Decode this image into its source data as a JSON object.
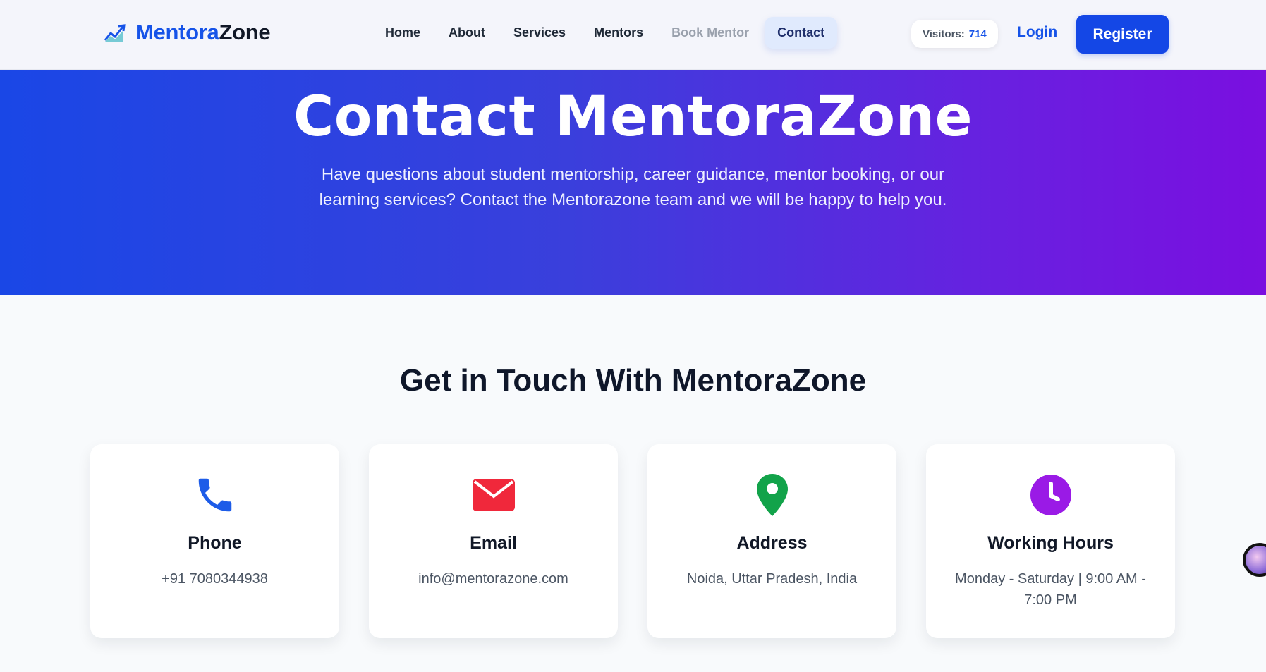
{
  "brand": {
    "name_part1": "Mentora",
    "name_part2": "Zone"
  },
  "nav": {
    "items": [
      {
        "label": "Home"
      },
      {
        "label": "About"
      },
      {
        "label": "Services"
      },
      {
        "label": "Mentors"
      },
      {
        "label": "Book Mentor"
      },
      {
        "label": "Contact"
      }
    ],
    "active": "Contact"
  },
  "visitors": {
    "label": "Visitors:",
    "count": "714"
  },
  "auth": {
    "login_label": "Login",
    "register_label": "Register"
  },
  "hero": {
    "title": "Contact MentoraZone",
    "subtitle": "Have questions about student mentorship, career guidance, mentor booking, or our learning services? Contact the Mentorazone team and we will be happy to help you."
  },
  "section": {
    "title": "Get in Touch With MentoraZone"
  },
  "cards": [
    {
      "icon": "phone-icon",
      "title": "Phone",
      "text": "+91 7080344938"
    },
    {
      "icon": "email-icon",
      "title": "Email",
      "text": "info@mentorazone.com"
    },
    {
      "icon": "location-pin-icon",
      "title": "Address",
      "text": "Noida, Uttar Pradesh, India"
    },
    {
      "icon": "clock-icon",
      "title": "Working Hours",
      "text": "Monday - Saturday | 9:00 AM - 7:00 PM"
    }
  ],
  "colors": {
    "primary": "#1447e6",
    "hero_start": "#1a47e6",
    "hero_end": "#7a0fe0",
    "phone": "#1d5ce8",
    "email": "#f0283b",
    "address": "#12a34a",
    "hours": "#9a1ae6"
  }
}
